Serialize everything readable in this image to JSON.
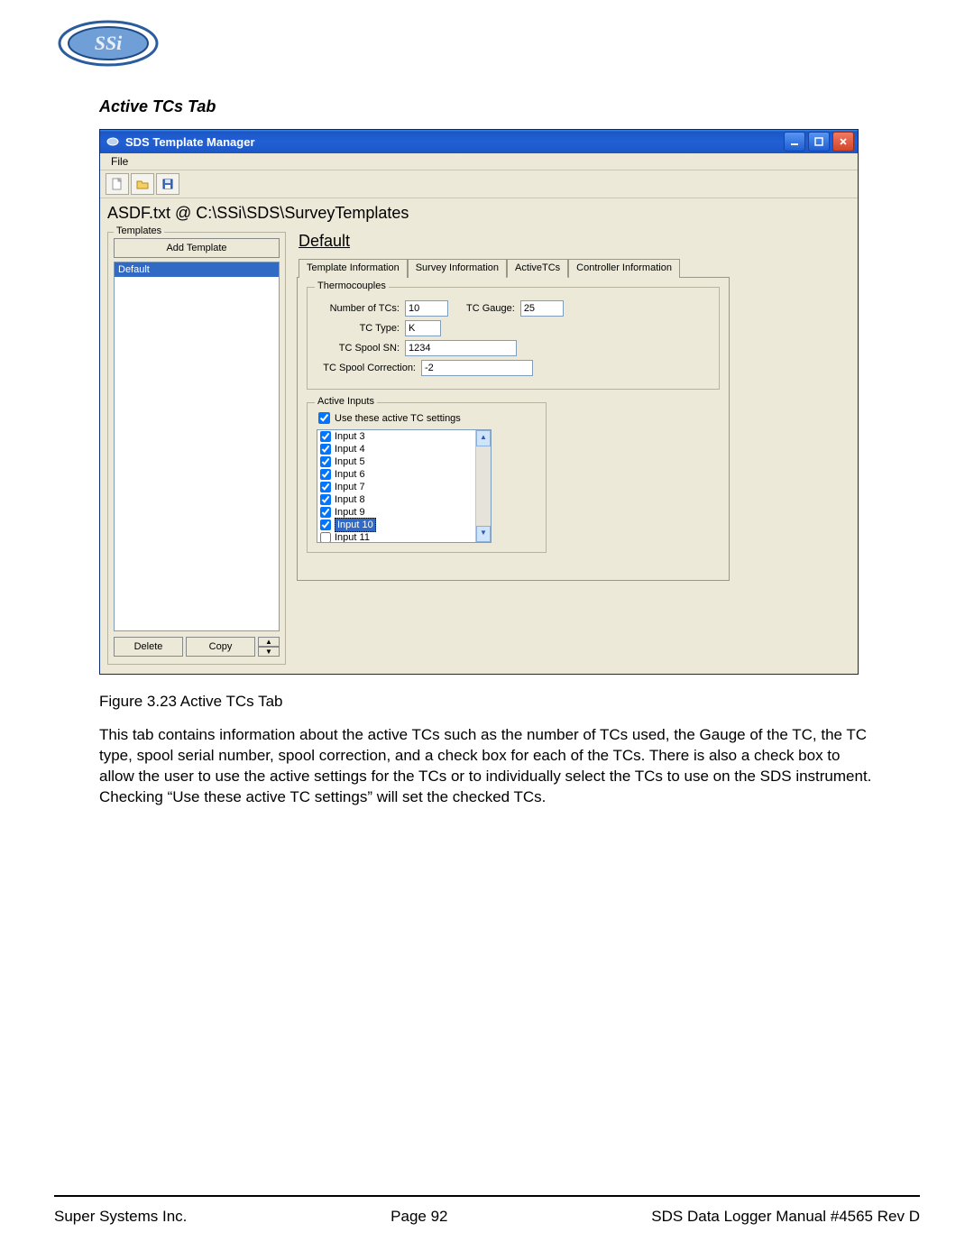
{
  "doc": {
    "section_title": "Active TCs Tab",
    "figure_caption": "Figure 3.23 Active TCs Tab",
    "paragraph": "This tab contains information about the active TCs such as the number of TCs used, the Gauge of the TC, the TC type, spool serial number, spool correction, and a check box for each of the TCs.  There is also a check box to allow the user to use the active settings for the TCs or to individually select the TCs to use on the SDS instrument.  Checking “Use these active TC settings” will set the checked TCs.",
    "footer_left": "Super Systems Inc.",
    "footer_center": "Page 92",
    "footer_right": "SDS Data Logger Manual #4565 Rev D"
  },
  "window": {
    "title": "SDS Template Manager",
    "menu_file": "File",
    "path_text": "ASDF.txt @ C:\\SSi\\SDS\\SurveyTemplates",
    "templates_label": "Templates",
    "add_template": "Add Template",
    "template_items": [
      "Default"
    ],
    "delete_btn": "Delete",
    "copy_btn": "Copy",
    "right_title": "Default",
    "tabs": {
      "t1": "Template Information",
      "t2": "Survey Information",
      "t3": "ActiveTCs",
      "t4": "Controller Information"
    },
    "thermo": {
      "legend": "Thermocouples",
      "num_label": "Number of TCs:",
      "num_value": "10",
      "gauge_label": "TC Gauge:",
      "gauge_value": "25",
      "type_label": "TC Type:",
      "type_value": "K",
      "spool_label": "TC Spool SN:",
      "spool_value": "1234",
      "corr_label": "TC Spool Correction:",
      "corr_value": "-2"
    },
    "active_inputs": {
      "legend": "Active Inputs",
      "use_label": "Use these active TC settings",
      "rows": [
        {
          "label": "Input 3",
          "checked": true,
          "selected": false
        },
        {
          "label": "Input 4",
          "checked": true,
          "selected": false
        },
        {
          "label": "Input 5",
          "checked": true,
          "selected": false
        },
        {
          "label": "Input 6",
          "checked": true,
          "selected": false
        },
        {
          "label": "Input 7",
          "checked": true,
          "selected": false
        },
        {
          "label": "Input 8",
          "checked": true,
          "selected": false
        },
        {
          "label": "Input 9",
          "checked": true,
          "selected": false
        },
        {
          "label": "Input 10",
          "checked": true,
          "selected": true
        },
        {
          "label": "Input 11",
          "checked": false,
          "selected": false
        }
      ]
    }
  }
}
